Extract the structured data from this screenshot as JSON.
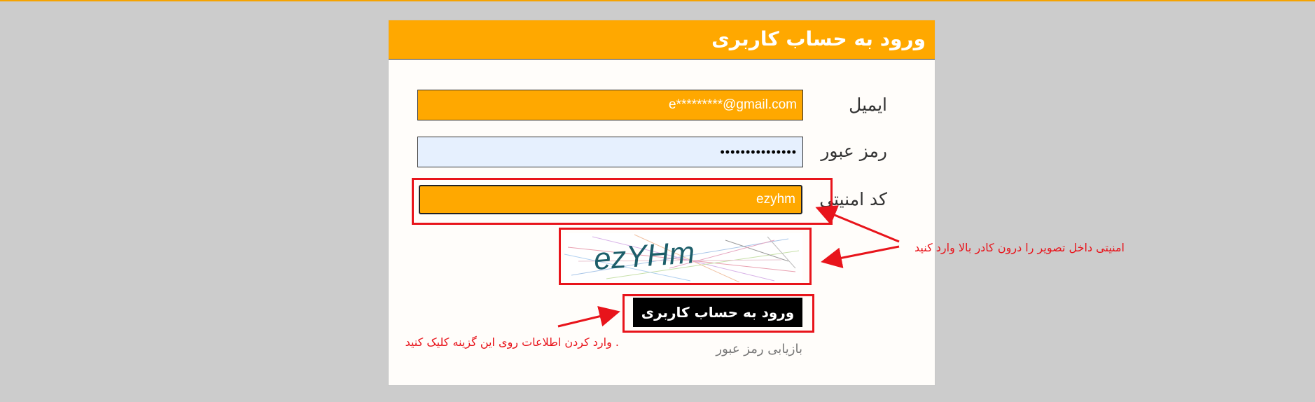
{
  "header": {
    "title": "ورود به حساب کاربری"
  },
  "form": {
    "email_label": "ایمیل",
    "email_value": "e*********@gmail.com",
    "password_label": "رمز عبور",
    "password_value": "•••••••••••••••",
    "captcha_label": "کد امنیتی",
    "captcha_value": "ezyhm",
    "captcha_image_text": "ezYHm",
    "submit_label": "ورود به حساب کاربری",
    "forgot_password_label": "بازیابی رمز عبور"
  },
  "annotations": {
    "captcha_note": "امنیتی داخل تصویر را درون کادر بالا وارد کنید",
    "submit_note": ". وارد کردن اطلاعات روی این گزینه کلیک کنید"
  },
  "colors": {
    "accent": "#ffa800",
    "annotation_red": "#e8141b",
    "background": "#cccccc"
  }
}
